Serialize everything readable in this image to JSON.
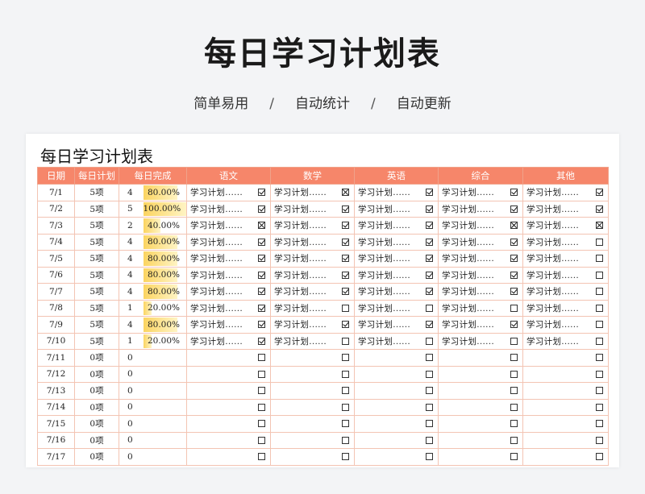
{
  "header": {
    "title": "每日学习计划表",
    "tags": [
      "简单易用",
      "自动统计",
      "自动更新"
    ],
    "separator": "/"
  },
  "sheet": {
    "title": "每日学习计划表",
    "columns": [
      "日期",
      "每日计划",
      "每日完成",
      "语文",
      "数学",
      "英语",
      "综合",
      "其他"
    ],
    "rows": [
      {
        "date": "7/1",
        "plan": "5项",
        "done": "4",
        "pct": "80.00%",
        "pct_value": 0.8,
        "tasks": [
          {
            "text": "学习计划......",
            "state": "checked"
          },
          {
            "text": "学习计划......",
            "state": "crossed"
          },
          {
            "text": "学习计划......",
            "state": "checked"
          },
          {
            "text": "学习计划......",
            "state": "checked"
          },
          {
            "text": "学习计划......",
            "state": "checked"
          }
        ]
      },
      {
        "date": "7/2",
        "plan": "5项",
        "done": "5",
        "pct": "100.00%",
        "pct_value": 1.0,
        "tasks": [
          {
            "text": "学习计划......",
            "state": "checked"
          },
          {
            "text": "学习计划......",
            "state": "checked"
          },
          {
            "text": "学习计划......",
            "state": "checked"
          },
          {
            "text": "学习计划......",
            "state": "checked"
          },
          {
            "text": "学习计划......",
            "state": "checked"
          }
        ]
      },
      {
        "date": "7/3",
        "plan": "5项",
        "done": "2",
        "pct": "40.00%",
        "pct_value": 0.4,
        "tasks": [
          {
            "text": "学习计划......",
            "state": "crossed"
          },
          {
            "text": "学习计划......",
            "state": "checked"
          },
          {
            "text": "学习计划......",
            "state": "checked"
          },
          {
            "text": "学习计划......",
            "state": "crossed"
          },
          {
            "text": "学习计划......",
            "state": "crossed"
          }
        ]
      },
      {
        "date": "7/4",
        "plan": "5项",
        "done": "4",
        "pct": "80.00%",
        "pct_value": 0.8,
        "tasks": [
          {
            "text": "学习计划......",
            "state": "checked"
          },
          {
            "text": "学习计划......",
            "state": "checked"
          },
          {
            "text": "学习计划......",
            "state": "checked"
          },
          {
            "text": "学习计划......",
            "state": "checked"
          },
          {
            "text": "学习计划......",
            "state": "empty"
          }
        ]
      },
      {
        "date": "7/5",
        "plan": "5项",
        "done": "4",
        "pct": "80.00%",
        "pct_value": 0.8,
        "tasks": [
          {
            "text": "学习计划......",
            "state": "checked"
          },
          {
            "text": "学习计划......",
            "state": "checked"
          },
          {
            "text": "学习计划......",
            "state": "checked"
          },
          {
            "text": "学习计划......",
            "state": "checked"
          },
          {
            "text": "学习计划......",
            "state": "empty"
          }
        ]
      },
      {
        "date": "7/6",
        "plan": "5项",
        "done": "4",
        "pct": "80.00%",
        "pct_value": 0.8,
        "tasks": [
          {
            "text": "学习计划......",
            "state": "checked"
          },
          {
            "text": "学习计划......",
            "state": "checked"
          },
          {
            "text": "学习计划......",
            "state": "checked"
          },
          {
            "text": "学习计划......",
            "state": "checked"
          },
          {
            "text": "学习计划......",
            "state": "empty"
          }
        ]
      },
      {
        "date": "7/7",
        "plan": "5项",
        "done": "4",
        "pct": "80.00%",
        "pct_value": 0.8,
        "tasks": [
          {
            "text": "学习计划......",
            "state": "checked"
          },
          {
            "text": "学习计划......",
            "state": "checked"
          },
          {
            "text": "学习计划......",
            "state": "checked"
          },
          {
            "text": "学习计划......",
            "state": "checked"
          },
          {
            "text": "学习计划......",
            "state": "empty"
          }
        ]
      },
      {
        "date": "7/8",
        "plan": "5项",
        "done": "1",
        "pct": "20.00%",
        "pct_value": 0.2,
        "tasks": [
          {
            "text": "学习计划......",
            "state": "checked"
          },
          {
            "text": "学习计划......",
            "state": "empty"
          },
          {
            "text": "学习计划......",
            "state": "empty"
          },
          {
            "text": "学习计划......",
            "state": "empty"
          },
          {
            "text": "学习计划......",
            "state": "empty"
          }
        ]
      },
      {
        "date": "7/9",
        "plan": "5项",
        "done": "4",
        "pct": "80.00%",
        "pct_value": 0.8,
        "tasks": [
          {
            "text": "学习计划......",
            "state": "checked"
          },
          {
            "text": "学习计划......",
            "state": "checked"
          },
          {
            "text": "学习计划......",
            "state": "checked"
          },
          {
            "text": "学习计划......",
            "state": "checked"
          },
          {
            "text": "学习计划......",
            "state": "empty"
          }
        ]
      },
      {
        "date": "7/10",
        "plan": "5项",
        "done": "1",
        "pct": "20.00%",
        "pct_value": 0.2,
        "tasks": [
          {
            "text": "学习计划......",
            "state": "checked"
          },
          {
            "text": "学习计划......",
            "state": "empty"
          },
          {
            "text": "学习计划......",
            "state": "empty"
          },
          {
            "text": "学习计划......",
            "state": "empty"
          },
          {
            "text": "学习计划......",
            "state": "empty"
          }
        ]
      },
      {
        "date": "7/11",
        "plan": "0项",
        "done": "0",
        "pct": "",
        "pct_value": 0,
        "tasks": [
          {
            "text": "",
            "state": "empty"
          },
          {
            "text": "",
            "state": "empty"
          },
          {
            "text": "",
            "state": "empty"
          },
          {
            "text": "",
            "state": "empty"
          },
          {
            "text": "",
            "state": "empty"
          }
        ]
      },
      {
        "date": "7/12",
        "plan": "0项",
        "done": "0",
        "pct": "",
        "pct_value": 0,
        "tasks": [
          {
            "text": "",
            "state": "empty"
          },
          {
            "text": "",
            "state": "empty"
          },
          {
            "text": "",
            "state": "empty"
          },
          {
            "text": "",
            "state": "empty"
          },
          {
            "text": "",
            "state": "empty"
          }
        ]
      },
      {
        "date": "7/13",
        "plan": "0项",
        "done": "0",
        "pct": "",
        "pct_value": 0,
        "tasks": [
          {
            "text": "",
            "state": "empty"
          },
          {
            "text": "",
            "state": "empty"
          },
          {
            "text": "",
            "state": "empty"
          },
          {
            "text": "",
            "state": "empty"
          },
          {
            "text": "",
            "state": "empty"
          }
        ]
      },
      {
        "date": "7/14",
        "plan": "0项",
        "done": "0",
        "pct": "",
        "pct_value": 0,
        "tasks": [
          {
            "text": "",
            "state": "empty"
          },
          {
            "text": "",
            "state": "empty"
          },
          {
            "text": "",
            "state": "empty"
          },
          {
            "text": "",
            "state": "empty"
          },
          {
            "text": "",
            "state": "empty"
          }
        ]
      },
      {
        "date": "7/15",
        "plan": "0项",
        "done": "0",
        "pct": "",
        "pct_value": 0,
        "tasks": [
          {
            "text": "",
            "state": "empty"
          },
          {
            "text": "",
            "state": "empty"
          },
          {
            "text": "",
            "state": "empty"
          },
          {
            "text": "",
            "state": "empty"
          },
          {
            "text": "",
            "state": "empty"
          }
        ]
      },
      {
        "date": "7/16",
        "plan": "0项",
        "done": "0",
        "pct": "",
        "pct_value": 0,
        "tasks": [
          {
            "text": "",
            "state": "empty"
          },
          {
            "text": "",
            "state": "empty"
          },
          {
            "text": "",
            "state": "empty"
          },
          {
            "text": "",
            "state": "empty"
          },
          {
            "text": "",
            "state": "empty"
          }
        ]
      },
      {
        "date": "7/17",
        "plan": "0项",
        "done": "0",
        "pct": "",
        "pct_value": 0,
        "tasks": [
          {
            "text": "",
            "state": "empty"
          },
          {
            "text": "",
            "state": "empty"
          },
          {
            "text": "",
            "state": "empty"
          },
          {
            "text": "",
            "state": "empty"
          },
          {
            "text": "",
            "state": "empty"
          }
        ]
      }
    ]
  },
  "colors": {
    "header_bg": "#f6866a",
    "grid_line": "#f3c4b3",
    "progress_bar": "#fbd460"
  },
  "icons": {
    "checked": "checkbox-checked-icon",
    "crossed": "checkbox-crossed-icon",
    "empty": "checkbox-empty-icon"
  }
}
